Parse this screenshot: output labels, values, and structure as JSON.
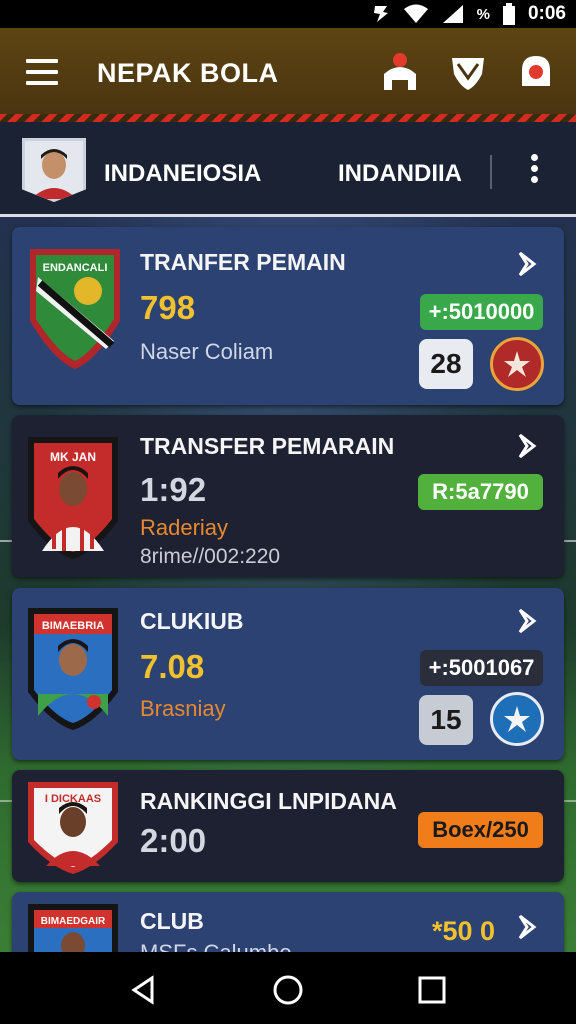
{
  "status_bar": {
    "time": "0:06",
    "battery_percent_label": "%"
  },
  "app_bar": {
    "title": "NEPAK BOLA",
    "icons": [
      "menu-icon",
      "team-icon",
      "shield-icon",
      "notification-icon"
    ]
  },
  "profile": {
    "name_left": "INDANEIOSIA",
    "name_right": "INDANDIIA"
  },
  "cards": [
    {
      "style": "blue",
      "crest_text": "ENDANCALI",
      "title": "TRANFER PEMAIN",
      "number": "798",
      "number_color": "#f2c12e",
      "sub1": "Naser Coliam",
      "sub1_color": "#cfd6e6",
      "pill": "+:5010000",
      "pill_color": "#38a84a",
      "rank": "28",
      "badge_color": "#b02a2a"
    },
    {
      "style": "dark",
      "crest_text": "MK JAN",
      "title": "TRANSFER PEMARAIN",
      "number": "1:92",
      "number_color": "#d3d7e0",
      "sub1": "Raderiay",
      "sub1_color": "#e8882f",
      "sub2": "8rime//002:220",
      "pill": "R:5a7790",
      "pill_color": "#52b13d"
    },
    {
      "style": "blue",
      "crest_text": "BIMAEBRIA",
      "title": "CLUKIUB",
      "number": "7.08",
      "number_color": "#f2c12e",
      "sub1": "Brasniay",
      "sub1_color": "#e8882f",
      "pill": "+:5001067",
      "pill_color": "#2a2e3a",
      "rank": "15",
      "badge_color": "#1f6fb8"
    },
    {
      "style": "dark",
      "crest_text": "I DICKAAS",
      "title": "RANKINGGI LNPIDANA",
      "number": "2:00",
      "number_color": "#d3d7e0",
      "pill": "Boex/250",
      "pill_color": "#f07c1a"
    },
    {
      "style": "blue",
      "crest_text": "BIMAEDGAIR",
      "title": "CLUB",
      "sub1": "MSFs Calumbo",
      "value": "*50 0",
      "value_color": "#f2c12e"
    }
  ],
  "nav_bar": {
    "icons": [
      "back-icon",
      "home-icon",
      "recents-icon"
    ]
  }
}
